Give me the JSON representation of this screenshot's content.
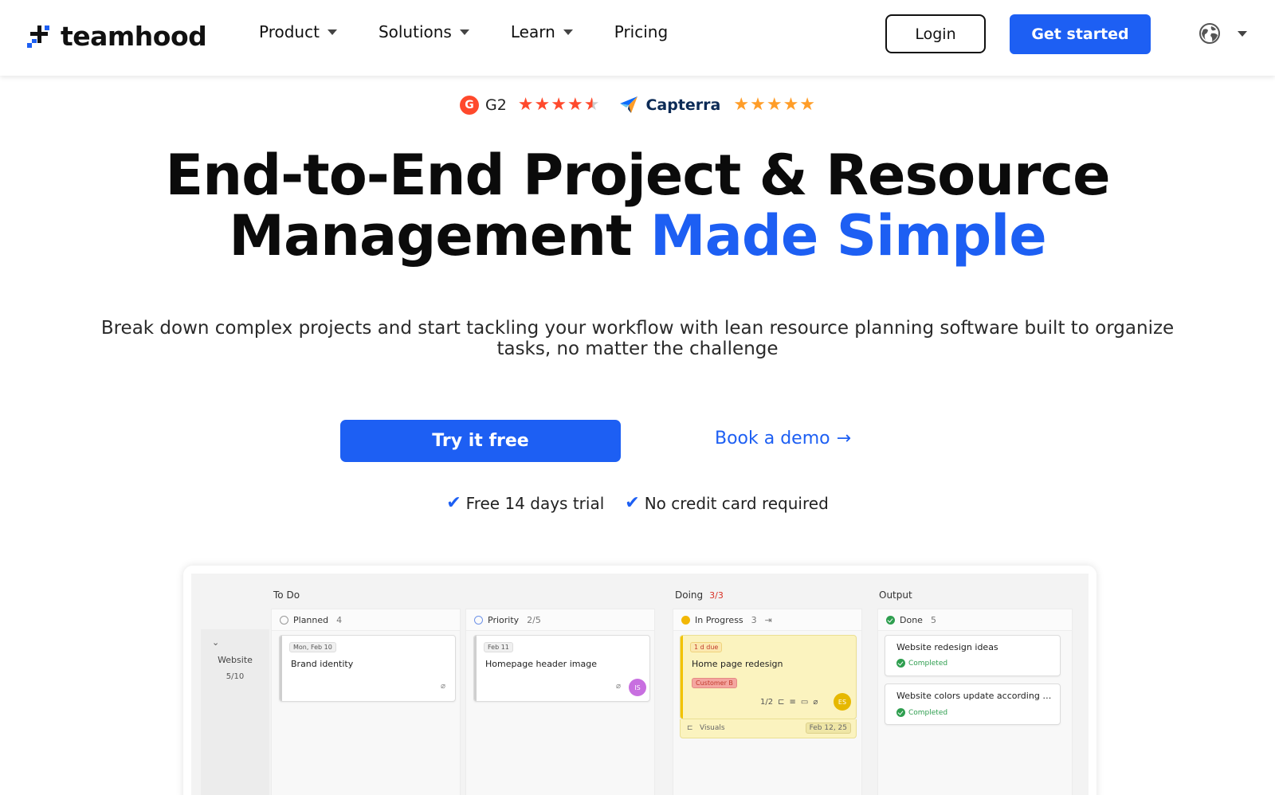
{
  "nav": {
    "logo_text": "teamhood",
    "items": [
      {
        "label": "Product",
        "has_dropdown": true
      },
      {
        "label": "Solutions",
        "has_dropdown": true
      },
      {
        "label": "Learn",
        "has_dropdown": true
      },
      {
        "label": "Pricing",
        "has_dropdown": false
      }
    ],
    "login_label": "Login",
    "get_started_label": "Get started",
    "language_icon": "globe-icon"
  },
  "ratings": {
    "g2": {
      "badge": "G",
      "label": "G2",
      "stars": 4.5,
      "star_color": "#ff492c"
    },
    "capterra": {
      "label": "Capterra",
      "stars": 5,
      "star_color": "#ff9d28"
    }
  },
  "hero": {
    "title_line1": "End-to-End Project & Resource",
    "title_line2_plain": "Management ",
    "title_line2_accent": "Made Simple",
    "subtitle": "Break down complex projects and start tackling your workflow with lean resource planning software built to organize tasks, no matter the challenge",
    "try_label": "Try it free",
    "demo_label": "Book a demo",
    "demo_arrow": "→",
    "checks": [
      "Free 14 days trial",
      "No credit card required"
    ]
  },
  "board": {
    "columns": [
      {
        "label": "To Do",
        "count": ""
      },
      {
        "label": "Doing",
        "count": "3/3"
      },
      {
        "label": "Output",
        "count": ""
      }
    ],
    "sub_columns": [
      {
        "label": "Planned",
        "count": "4"
      },
      {
        "label": "Priority",
        "count": "2/5"
      },
      {
        "label": "In Progress",
        "count": "3"
      },
      {
        "label": "Done",
        "count": "5"
      }
    ],
    "lane": {
      "name": "Website",
      "count": "5/10"
    },
    "cards": {
      "brand": {
        "date": "Mon, Feb 10",
        "title": "Brand identity"
      },
      "homepage": {
        "date": "Feb 11",
        "title": "Homepage header image",
        "avatar": "IS"
      },
      "redesign": {
        "due": "1 d due",
        "title": "Home page redesign",
        "label": "Customer B",
        "checklist": "1/2",
        "avatar": "ES",
        "footer_left": "Visuals",
        "footer_date": "Feb 12, 25"
      },
      "ideas": {
        "title": "Website redesign ideas",
        "status": "Completed"
      },
      "colors": {
        "title": "Website colors update according to t...",
        "status": "Completed"
      }
    }
  },
  "colors": {
    "primary": "#1d5ff3",
    "text": "#0b0b0b"
  }
}
